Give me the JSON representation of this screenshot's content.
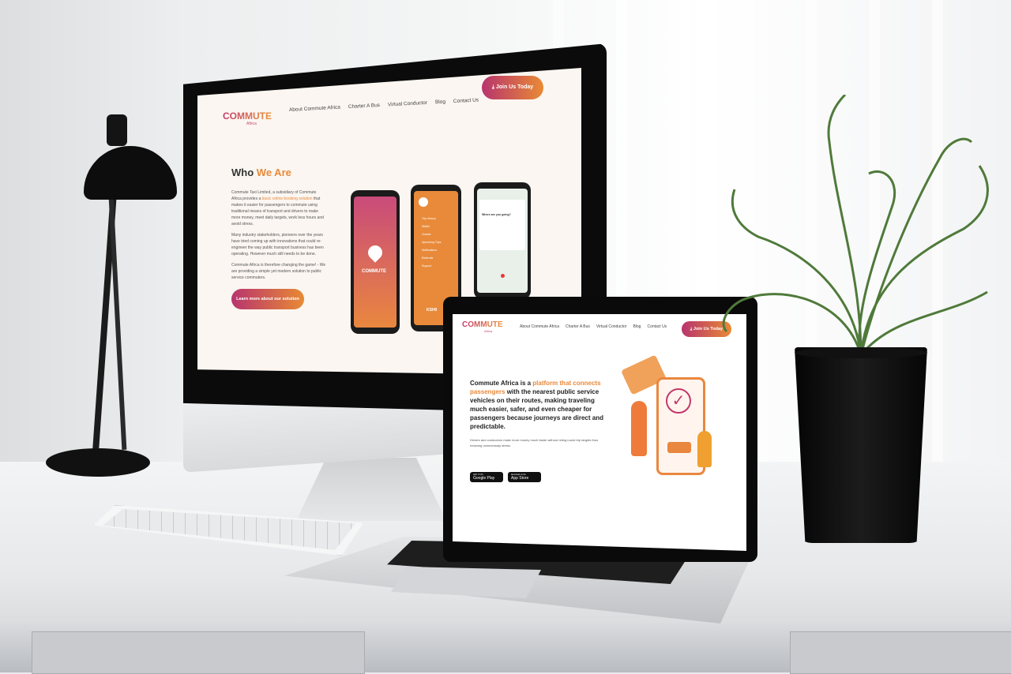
{
  "desktop_site": {
    "logo": "COMMUTE",
    "logo_sub": "Africa",
    "nav": [
      "About Commute Africa",
      "Charter A Bus",
      "Virtual Conductor",
      "Blog",
      "Contact Us"
    ],
    "cta": "Join Us Today",
    "heading_plain": "Who",
    "heading_accent": "We Are",
    "para1_a": "Commute Taxi Limited, a subsidiary of Commute Africa provides a",
    "para1_link": "basic online booking solution",
    "para1_b": "that makes it easier for passengers to commute using traditional means of transport and drivers to make more money, meet daily targets, work less hours and avoid stress.",
    "para2": "Many industry stakeholders, pioneers over the years have tried coming up with innovations that could re-engineer the way public transport business has been operating. However much still needs to be done.",
    "para3": "Commute Africa is therefore changing the game! - We are providing a simple yet modern solution to public service commuters.",
    "button": "Learn more about our solution",
    "phone_menu": [
      "Trip History",
      "Wallet",
      "Charter",
      "Upcoming Trips",
      "Notifications",
      "Referrals",
      "Support"
    ],
    "phone_where": "Where are you going?",
    "phone_balance": "KSH0"
  },
  "laptop_site": {
    "logo": "COMMUTE",
    "logo_sub": "Africa",
    "nav": [
      "About Commute Africa",
      "Charter A Bus",
      "Virtual Conductor",
      "Blog",
      "Contact Us"
    ],
    "cta": "Join Us Today",
    "hero_a": "Commute Africa is a",
    "hero_accent": "platform that connects passengers",
    "hero_b": "with the nearest public service vehicles on their routes, making traveling much easier, safer, and even cheaper for passengers because journeys are direct and predictable.",
    "sub": "Drivers and conductors make more money much faster without riding round trip targets thus reducing unnecessary stress.",
    "google_small": "GET IT ON",
    "google": "Google Play",
    "apple_small": "Download on the",
    "apple": "App Store"
  },
  "colors": {
    "brand_magenta": "#b8346e",
    "brand_orange": "#e88a34"
  }
}
